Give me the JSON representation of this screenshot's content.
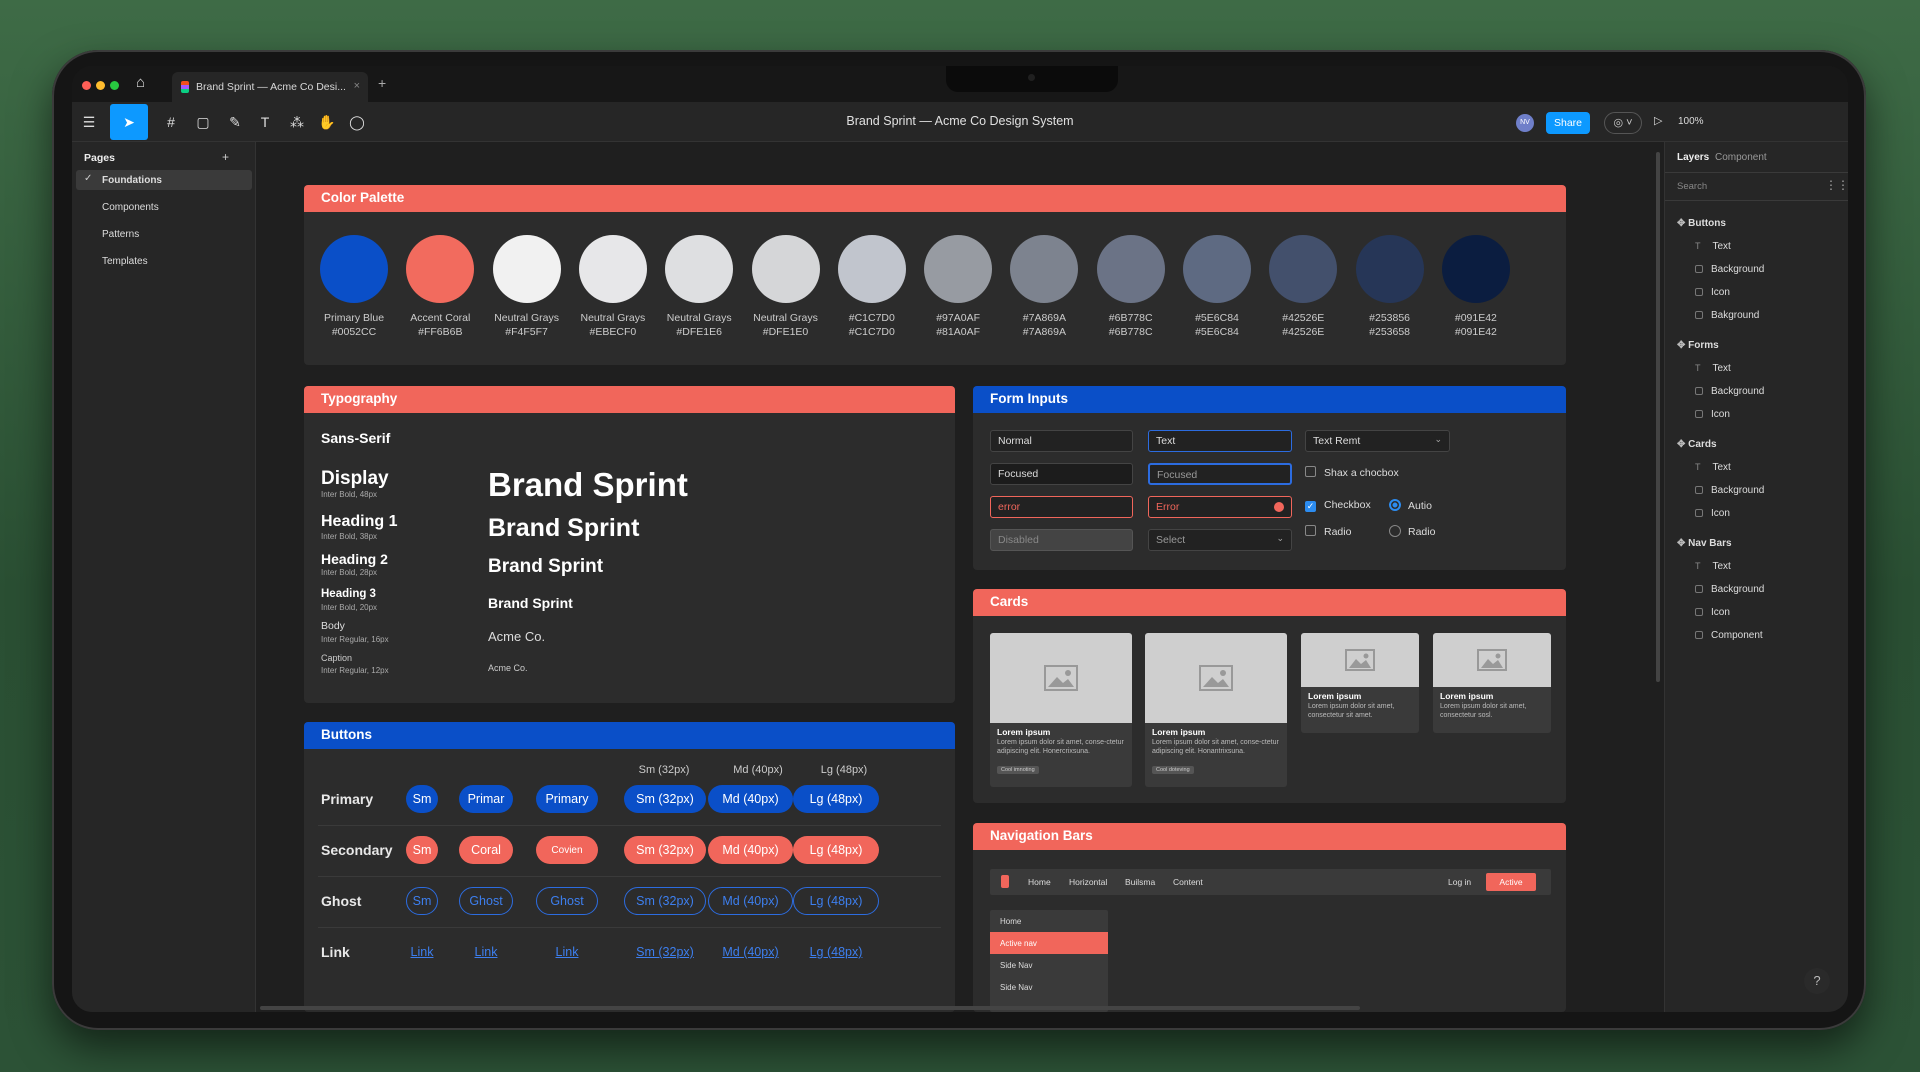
{
  "tab": {
    "title": "Brand Sprint — Acme Co Desi...",
    "close": "×",
    "new": "+"
  },
  "toolbar": {
    "title": "Brand Sprint — Acme Co Design System",
    "share": "Share",
    "zoom": "100%",
    "avatar": "NV"
  },
  "pages": {
    "title": "Pages",
    "add": "+",
    "items": [
      "Foundations",
      "Components",
      "Patterns",
      "Templates"
    ]
  },
  "right": {
    "tabs": [
      "Layers",
      "Component"
    ],
    "search": "Search",
    "groups": [
      {
        "name": "Buttons",
        "items": [
          "Text",
          "Background",
          "Icon",
          "Bakground"
        ]
      },
      {
        "name": "Forms",
        "items": [
          "Text",
          "Background",
          "Icon"
        ]
      },
      {
        "name": "Cards",
        "items": [
          "Text",
          "Background",
          "Icon"
        ]
      },
      {
        "name": "Nav Bars",
        "items": [
          "Text",
          "Background",
          "Icon",
          "Component"
        ]
      }
    ]
  },
  "palette": {
    "title": "Color Palette",
    "swatches": [
      {
        "name": "Primary Blue",
        "hex": "#0052CC",
        "color": "#0a4fc8"
      },
      {
        "name": "Accent Coral",
        "hex": "#FF6B6B",
        "color": "#f26b5e"
      },
      {
        "name": "Neutral Grays",
        "hex": "#F4F5F7",
        "color": "#f1f1f1"
      },
      {
        "name": "Neutral Grays",
        "hex": "#EBECF0",
        "color": "#e7e7e9"
      },
      {
        "name": "Neutral Grays",
        "hex": "#DFE1E6",
        "color": "#dedfe1"
      },
      {
        "name": "Neutral Grays",
        "hex": "#DFE1E0",
        "color": "#d5d6d8"
      },
      {
        "name": "#C1C7D0",
        "hex": "#C1C7D0",
        "color": "#c1c5cd"
      },
      {
        "name": "#97A0AF",
        "hex": "#81A0AF",
        "color": "#979ba2"
      },
      {
        "name": "#7A869A",
        "hex": "#7A869A",
        "color": "#7d838f"
      },
      {
        "name": "#6B778C",
        "hex": "#6B778C",
        "color": "#6b7386"
      },
      {
        "name": "#5E6C84",
        "hex": "#5E6C84",
        "color": "#5e6a82"
      },
      {
        "name": "#42526E",
        "hex": "#42526E",
        "color": "#43506c"
      },
      {
        "name": "#253856",
        "hex": "#253658",
        "color": "#263657"
      },
      {
        "name": "#091E42",
        "hex": "#091E42",
        "color": "#0b1d40"
      }
    ]
  },
  "typography": {
    "title": "Typography",
    "family": "Sans-Serif",
    "specs": [
      {
        "name": "Display",
        "spec": "Inter Bold, 48px"
      },
      {
        "name": "Heading 1",
        "spec": "Inter Bold, 38px"
      },
      {
        "name": "Heading 2",
        "spec": "Inter Bold, 28px"
      },
      {
        "name": "Heading 3",
        "spec": "Inter Bold, 20px"
      },
      {
        "name": "Body",
        "spec": "Inter Regular, 16px"
      },
      {
        "name": "Caption",
        "spec": "Inter Regular, 12px"
      }
    ],
    "samples": [
      "Brand Sprint",
      "Brand Sprint",
      "Brand Sprint",
      "Brand Sprint",
      "Acme Co.",
      "Acme Co."
    ]
  },
  "forms": {
    "title": "Form Inputs",
    "normal": "Normal",
    "text": "Text",
    "text_remt": "Text Remt",
    "focused": "Focused",
    "focused2": "Focused",
    "shax": "Shax a chocbox",
    "error": "error",
    "error2": "Error",
    "checkbox": "Checkbox",
    "autio": "Autio",
    "disabled": "Disabled",
    "select": "Select",
    "radio1": "Radio",
    "radio2": "Radio"
  },
  "cards": {
    "title": "Cards",
    "items": [
      {
        "t": "Lorem ipsum",
        "d": "Lorem ipsum dolor sit amet, conse-ctetur adipiscing elit. Honercrixsuna.",
        "tag": "Cool imnoting"
      },
      {
        "t": "Lorem ipsum",
        "d": "Lorem ipsum dolor sit amet, conse-ctetur adipiscing elit. Honantrixsuna.",
        "tag": "Cool doteving"
      },
      {
        "t": "Lorem ipsum",
        "d": "Lorem ipsum dolor sit amet, consectetur sit amet."
      },
      {
        "t": "Lorem ipsum",
        "d": "Lorem ipsum dolor sit amet, consectetur sosl."
      }
    ]
  },
  "buttons": {
    "title": "Buttons",
    "sizes": [
      "Sm (32px)",
      "Md (40px)",
      "Lg (48px)"
    ],
    "rows": [
      {
        "label": "Primary",
        "b": [
          "Sm",
          "Primar",
          "Primary",
          "Sm (32px)",
          "Md (40px)",
          "Lg (48px)"
        ]
      },
      {
        "label": "Secondary",
        "b": [
          "Sm",
          "Coral",
          "Covien",
          "Sm (32px)",
          "Md (40px)",
          "Lg (48px)"
        ]
      },
      {
        "label": "Ghost",
        "b": [
          "Sm",
          "Ghost",
          "Ghost",
          "Sm (32px)",
          "Md (40px)",
          "Lg (48px)"
        ]
      },
      {
        "label": "Link",
        "b": [
          "Link",
          "Link",
          "Link",
          "Sm (32px)",
          "Md (40px)",
          "Lg (48px)"
        ]
      }
    ]
  },
  "nav": {
    "title": "Navigation Bars",
    "items": [
      "Home",
      "Horizontal",
      "Builsma",
      "Content"
    ],
    "login": "Log in",
    "active": "Active",
    "side": [
      "Home",
      "Active nav",
      "Side Nav",
      "Side Nav"
    ]
  },
  "help": "?"
}
